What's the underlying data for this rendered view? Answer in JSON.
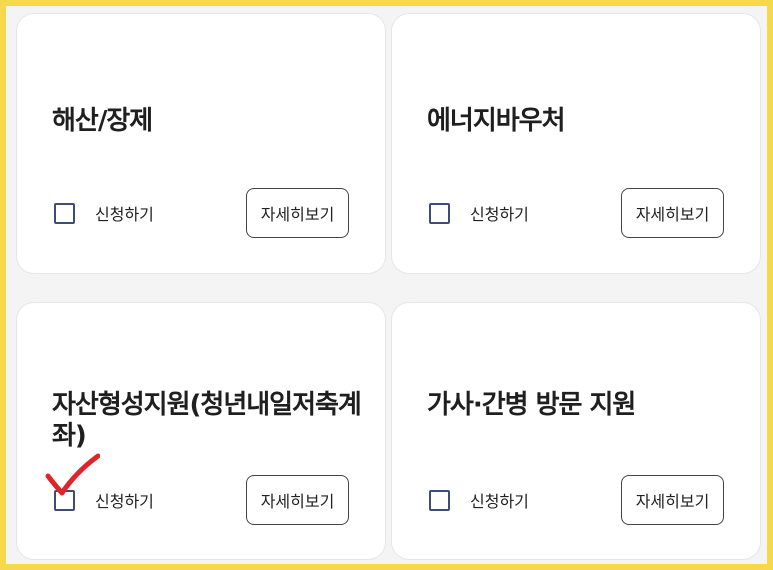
{
  "cards": [
    {
      "title": "해산/장제",
      "apply_label": "신청하기",
      "detail_label": "자세히보기",
      "checked": false
    },
    {
      "title": "에너지바우처",
      "apply_label": "신청하기",
      "detail_label": "자세히보기",
      "checked": false
    },
    {
      "title": "자산형성지원(청년내일저축계좌)",
      "apply_label": "신청하기",
      "detail_label": "자세히보기",
      "checked": true
    },
    {
      "title": "가사·간병 방문 지원",
      "apply_label": "신청하기",
      "detail_label": "자세히보기",
      "checked": false
    }
  ],
  "colors": {
    "border_frame": "#f5d94a",
    "checkbox": "#3e4d78",
    "checkmark": "#e0242b"
  },
  "icons": {
    "annotation": "red-checkmark-icon"
  }
}
